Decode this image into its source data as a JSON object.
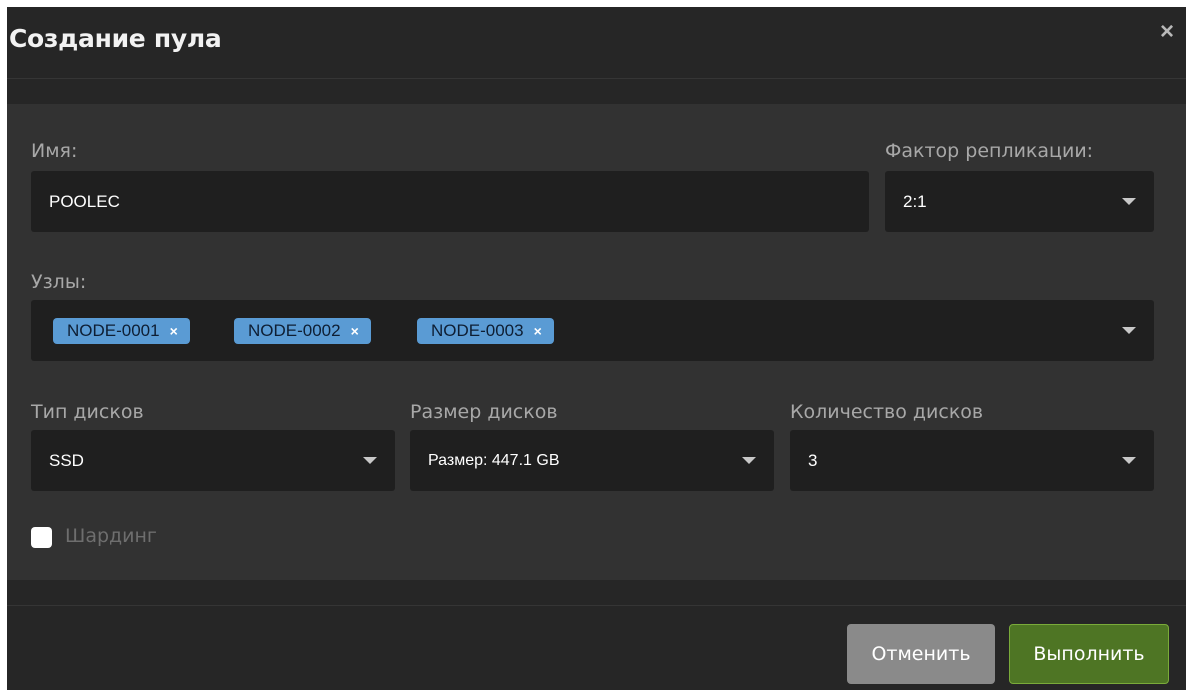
{
  "dialog": {
    "title": "Создание пула",
    "close_icon": "close-icon"
  },
  "form": {
    "name": {
      "label": "Имя:",
      "value": "POOLEC"
    },
    "replication": {
      "label": "Фактор репликации:",
      "value": "2:1"
    },
    "nodes": {
      "label": "Узлы:",
      "tags": [
        "NODE-0001",
        "NODE-0002",
        "NODE-0003"
      ],
      "remove_glyph": "×"
    },
    "disk_type": {
      "label": "Тип дисков",
      "value": "SSD"
    },
    "disk_size": {
      "label": "Размер дисков",
      "value": "Размер: 447.1 GB"
    },
    "disk_count": {
      "label": "Количество дисков",
      "value": "3"
    },
    "sharding": {
      "label": "Шардинг",
      "checked": false
    }
  },
  "footer": {
    "cancel_label": "Отменить",
    "submit_label": "Выполнить"
  },
  "colors": {
    "tag": "#5a9bd4",
    "submit": "#4e7524",
    "cancel": "#8a8a8a"
  }
}
